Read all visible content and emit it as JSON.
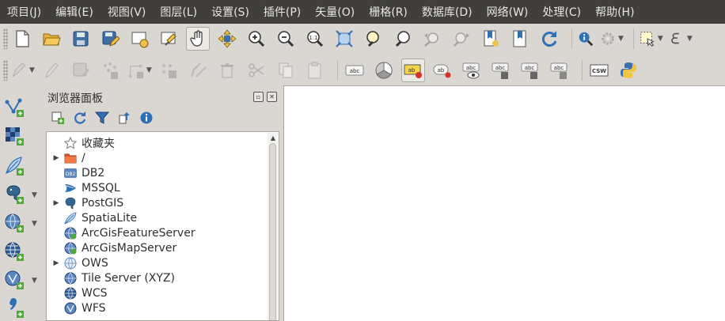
{
  "menu": [
    "项目(J)",
    "编辑(E)",
    "视图(V)",
    "图层(L)",
    "设置(S)",
    "插件(P)",
    "矢量(O)",
    "栅格(R)",
    "数据库(D)",
    "网络(W)",
    "处理(C)",
    "帮助(H)"
  ],
  "toolbar1": {
    "zoom_label": "1:1"
  },
  "toolbar2": {
    "label_abc": "abc",
    "label_ab": "ab",
    "csw_label": "CSW"
  },
  "left_toolbar": {
    "db2_badge": "DB2"
  },
  "browser_panel": {
    "title": "浏览器面板",
    "items": [
      {
        "label": "收藏夹",
        "icon": "star-icon",
        "expandable": false
      },
      {
        "label": "/",
        "icon": "folder-icon",
        "expandable": true
      },
      {
        "label": "DB2",
        "icon": "db2-icon",
        "expandable": false
      },
      {
        "label": "MSSQL",
        "icon": "mssql-icon",
        "expandable": false
      },
      {
        "label": "PostGIS",
        "icon": "postgis-icon",
        "expandable": true
      },
      {
        "label": "SpatiaLite",
        "icon": "spatialite-feather-icon",
        "expandable": false
      },
      {
        "label": "ArcGisFeatureServer",
        "icon": "arcgis-feature-icon",
        "expandable": false
      },
      {
        "label": "ArcGisMapServer",
        "icon": "arcgis-map-icon",
        "expandable": false
      },
      {
        "label": "OWS",
        "icon": "ows-globe-icon",
        "expandable": true
      },
      {
        "label": "Tile Server (XYZ)",
        "icon": "xyz-globe-icon",
        "expandable": false
      },
      {
        "label": "WCS",
        "icon": "wcs-globe-icon",
        "expandable": false
      },
      {
        "label": "WFS",
        "icon": "wfs-globe-icon",
        "expandable": false
      }
    ]
  },
  "colors": {
    "menubar_bg": "#403f3b",
    "window_bg": "#dad7d3",
    "accent_blue": "#2f6fb6",
    "add_green": "#4ea83a"
  }
}
